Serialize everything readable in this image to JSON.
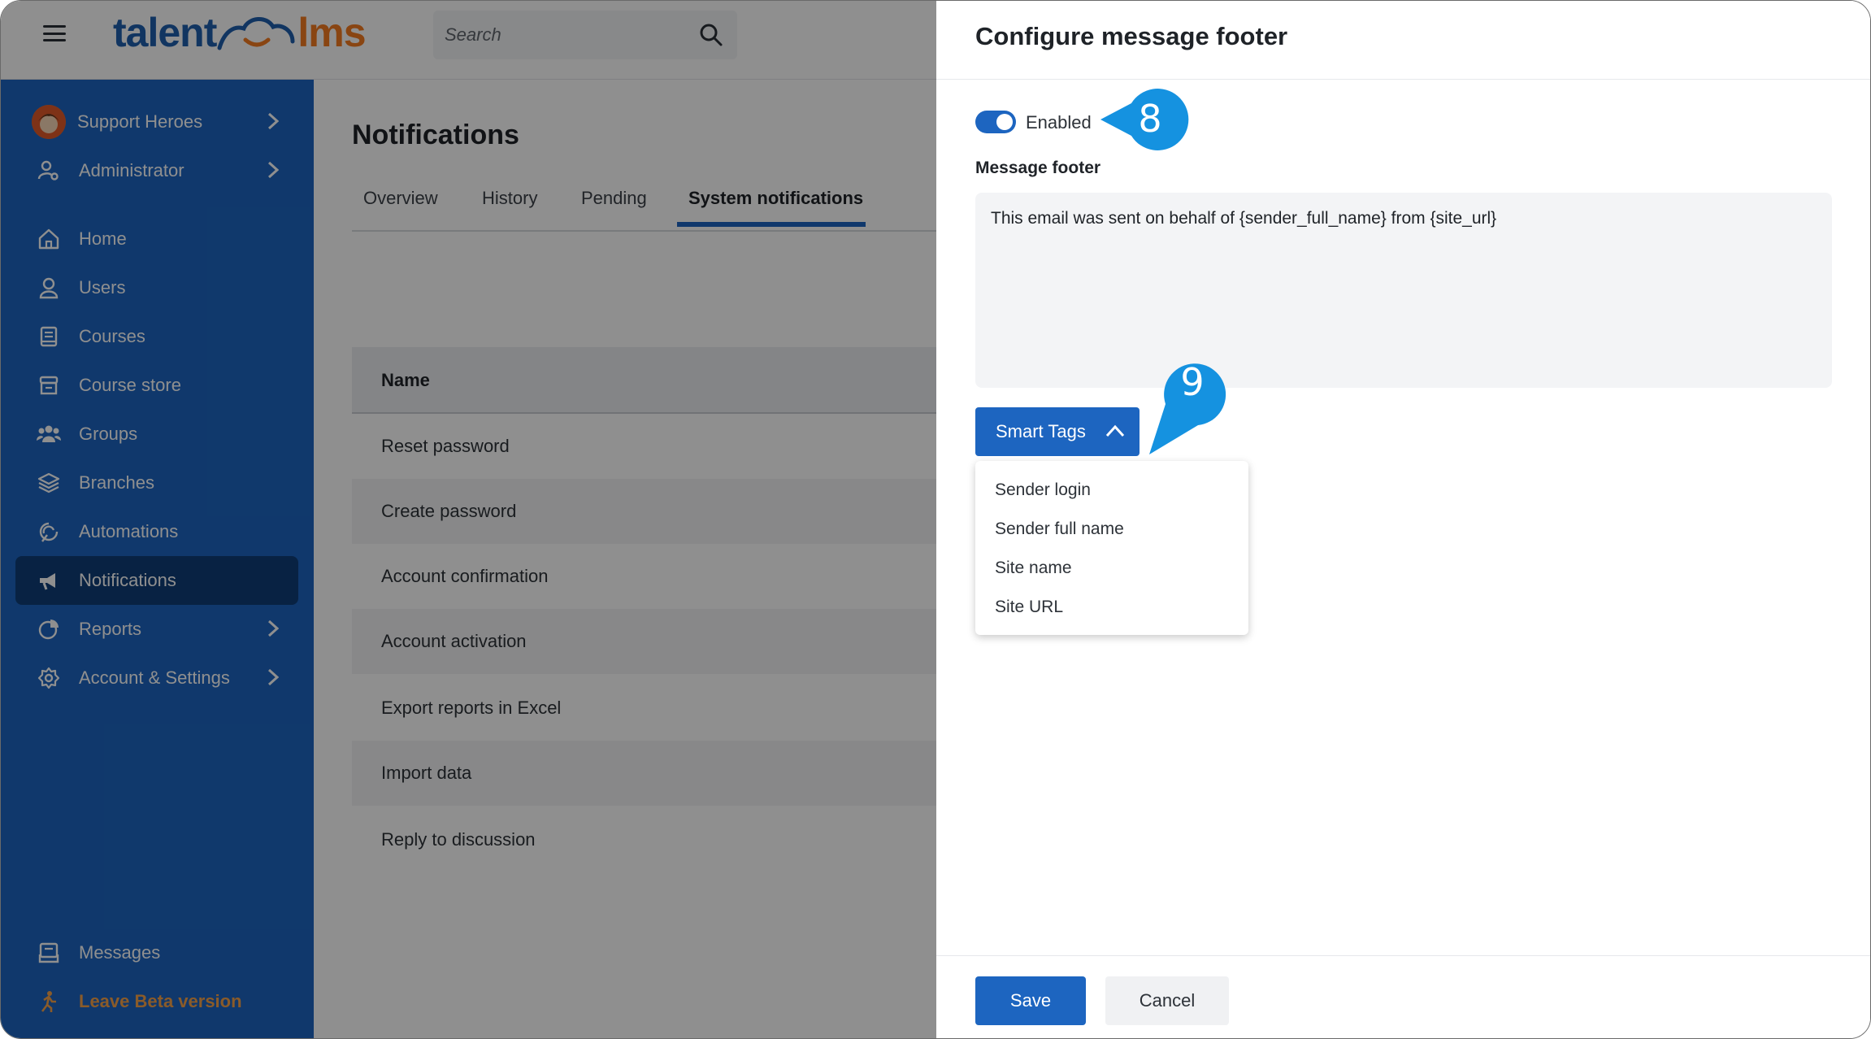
{
  "topbar": {
    "logo_talent": "talent",
    "logo_lms": "lms",
    "search_placeholder": "Search"
  },
  "sidebar": {
    "user": {
      "label": "Support Heroes"
    },
    "role": {
      "label": "Administrator"
    },
    "items": [
      {
        "label": "Home",
        "icon": "home-icon"
      },
      {
        "label": "Users",
        "icon": "user-icon"
      },
      {
        "label": "Courses",
        "icon": "book-icon"
      },
      {
        "label": "Course store",
        "icon": "store-icon"
      },
      {
        "label": "Groups",
        "icon": "groups-icon"
      },
      {
        "label": "Branches",
        "icon": "layers-icon"
      },
      {
        "label": "Automations",
        "icon": "automation-icon"
      },
      {
        "label": "Notifications",
        "icon": "megaphone-icon",
        "active": true
      },
      {
        "label": "Reports",
        "icon": "pie-chart-icon"
      },
      {
        "label": "Account & Settings",
        "icon": "gear-icon"
      }
    ],
    "messages": "Messages",
    "leave_beta": "Leave Beta version"
  },
  "main": {
    "title": "Notifications",
    "tabs": [
      "Overview",
      "History",
      "Pending",
      "System notifications"
    ],
    "active_tab": "System notifications",
    "table": {
      "header": "Name",
      "rows": [
        "Reset password",
        "Create password",
        "Account confirmation",
        "Account activation",
        "Export reports in Excel",
        "Import data",
        "Reply to discussion"
      ]
    }
  },
  "drawer": {
    "title": "Configure message footer",
    "toggle_label": "Enabled",
    "toggle_on": true,
    "field_label": "Message footer",
    "field_value": "This email was sent on behalf of {sender_full_name} from {site_url}",
    "smart_tags_label": "Smart Tags",
    "smart_tags_options": [
      "Sender login",
      "Sender full name",
      "Site name",
      "Site URL"
    ],
    "save_label": "Save",
    "cancel_label": "Cancel"
  },
  "callouts": {
    "step_8": "8",
    "step_9": "9"
  },
  "colors": {
    "accent": "#1d65c0",
    "sidebar": "#1d65c0",
    "active": "#0f3e78",
    "callout": "#1592e0",
    "brand_orange": "#f47b20"
  }
}
